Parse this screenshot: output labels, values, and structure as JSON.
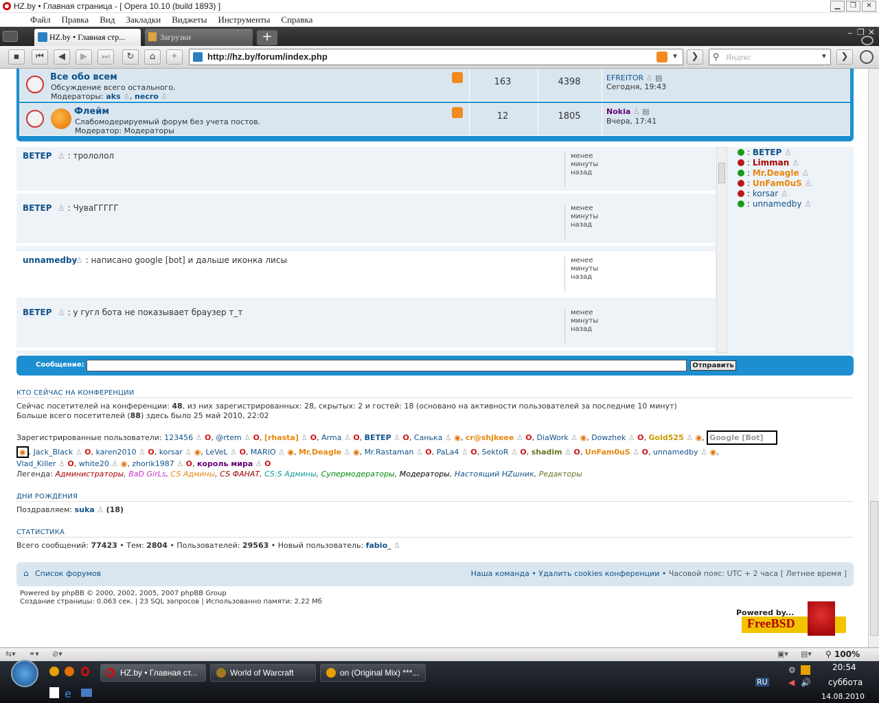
{
  "window": {
    "title": "HZ.by • Главная страница - [ Opera 10.10 (build 1893) ]"
  },
  "menu": [
    "Файл",
    "Правка",
    "Вид",
    "Закладки",
    "Виджеты",
    "Инструменты",
    "Справка"
  ],
  "tabs": [
    {
      "label": "HZ.by • Главная стр..."
    },
    {
      "label": "Загрузки"
    }
  ],
  "address": {
    "url": "http://hz.by/forum/index.php",
    "search_placeholder": "Яндекс"
  },
  "forums": [
    {
      "name": "Все обо всем",
      "desc": "Обсуждение всего остального.",
      "mods_label": "Модераторы:",
      "mods": [
        "aks",
        "necro"
      ],
      "topics": "163",
      "posts": "4398",
      "last_user": "EFREITOR",
      "last_time": "Сегодня, 19:43"
    },
    {
      "name": "Флейм",
      "desc": "Слабомодерируемый форум без учета постов.",
      "mods_label": "Модератор:",
      "mods": [
        "Модераторы"
      ],
      "topics": "12",
      "posts": "1805",
      "last_user": "Nokia",
      "last_time": "Вчера, 17:41"
    }
  ],
  "shoutbox": {
    "messages": [
      {
        "user": "ВЕТЕР",
        "text": ": трололол",
        "when": [
          "менее",
          "минуты",
          "назад"
        ]
      },
      {
        "user": "ВЕТЕР",
        "text": ": ЧуваГГГГГ",
        "when": [
          "менее",
          "минуты",
          "назад"
        ]
      },
      {
        "user": "unnamedby",
        "text": ": написано google [bot] и дальше иконка лисы",
        "when": [
          "менее",
          "минуты",
          "назад"
        ]
      },
      {
        "user": "ВЕТЕР",
        "text": ": у гугл бота не показывает браузер т_т",
        "when": [
          "менее",
          "минуты",
          "назад"
        ]
      }
    ],
    "online": [
      {
        "name": "ВЕТЕР",
        "status": "green",
        "color": "#105289"
      },
      {
        "name": "Limman",
        "status": "red",
        "color": "#aa0000"
      },
      {
        "name": "Mr.Deagle",
        "status": "green",
        "color": "#e8870e"
      },
      {
        "name": "UnFam0uS",
        "status": "red",
        "color": "#e8870e"
      },
      {
        "name": "korsar",
        "status": "red",
        "color": "#105289"
      },
      {
        "name": "unnamedby",
        "status": "green",
        "color": "#105289"
      }
    ],
    "message_label": "Сообщение:",
    "send_label": "Отправить"
  },
  "whoisonline": {
    "heading": "КТО СЕЙЧАС НА КОНФЕРЕНЦИИ",
    "line1_a": "Сейчас посетителей на конференции: ",
    "line1_num": "48",
    "line1_b": ", из них зарегистрированных: 28, скрытых: 2 и гостей: 18 (основано на активности пользователей за последние 10 минут)",
    "line2_a": "Больше всего посетителей (",
    "line2_num": "88",
    "line2_b": ") здесь было 25 май 2010, 22:02",
    "reg_label": "Зарегистрированные пользователи: ",
    "users_row1": [
      "123456",
      "@rtem",
      "[rhasta]",
      "Arma",
      "ВЕТЕР",
      "Санька",
      "cr@shjkeee",
      "DiaWork",
      "Dowzhek",
      "Gold525",
      "Google [Bot]"
    ],
    "users_row2": [
      "Jack_Black",
      "karen2010",
      "korsar",
      "LeVeL",
      "MARIO",
      "Mr.Deagle",
      "Mr.Rastaman",
      "PaLa4",
      "SektoR",
      "shadim",
      "UnFam0uS",
      "unnamedby"
    ],
    "users_row3": [
      "Vlad_Killer",
      "white20",
      "zhorik1987",
      "король мира"
    ],
    "legend_label": "Легенда: ",
    "legend": [
      {
        "name": "Администраторы",
        "color": "#aa0000"
      },
      {
        "name": "BaD GirLs",
        "color": "#cc33cc"
      },
      {
        "name": "CS Админы",
        "color": "#e8870e"
      },
      {
        "name": "CS ФАНАТ",
        "color": "#990000"
      },
      {
        "name": "CS:S Админы",
        "color": "#11999a"
      },
      {
        "name": "Супермодераторы",
        "color": "#00880a"
      },
      {
        "name": "Модераторы",
        "color": "#000000"
      },
      {
        "name": "Настоящий HZшник",
        "color": "#105289"
      },
      {
        "name": "Редакторы",
        "color": "#667722"
      }
    ]
  },
  "birthdays": {
    "heading": "ДНИ РОЖДЕНИЯ",
    "label": "Поздравляем: ",
    "user": "suka",
    "age": "(18)"
  },
  "stats": {
    "heading": "СТАТИСТИКА",
    "posts_label": "Всего сообщений: ",
    "posts": "77423",
    "topics_label": " • Тем: ",
    "topics": "2804",
    "users_label": " • Пользователей: ",
    "users": "29563",
    "new_label": " • Новый пользователь: ",
    "new_user": "fabio_"
  },
  "footer": {
    "index": "Список форумов",
    "team": "Наша команда",
    "cookies": "Удалить cookies конференции",
    "tz": "Часовой пояс: UTC + 2 часа [ Летнее время ]",
    "powered": "Powered by phpBB © 2000, 2002, 2005, 2007 phpBB Group",
    "gen": "Создание страницы: 0.063 сек. | 23 SQL запросов | Использованно памяти: 2.22 Мб",
    "freebsd_top": "Powered by...",
    "freebsd": "FreeBSD"
  },
  "statusbar": {
    "zoom": "100%"
  },
  "taskbar": {
    "items": [
      "HZ.by • Главная ст...",
      "World of Warcraft",
      "on (Original Mix) ***..."
    ],
    "lang": "RU",
    "time": "20:54",
    "day": "суббота",
    "date": "14.08.2010"
  }
}
